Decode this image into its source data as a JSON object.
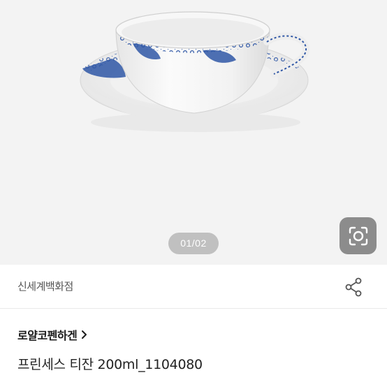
{
  "gallery": {
    "image_alt": "Royal Copenhagen Princess teacup and saucer",
    "page_indicator": "01/02",
    "lens_icon": "camera-lens-search-icon"
  },
  "seller": {
    "name": "신세계백화점",
    "share_icon": "share-icon"
  },
  "product": {
    "brand": "로얄코펜하겐",
    "brand_chevron_icon": "chevron-right-icon",
    "title": "프린세스 티잔 200ml_1104080"
  },
  "colors": {
    "gallery_bg": "#f3f3f3",
    "porcelain_blue": "#2f57a6",
    "text_primary": "#222222",
    "text_secondary": "#555555"
  }
}
